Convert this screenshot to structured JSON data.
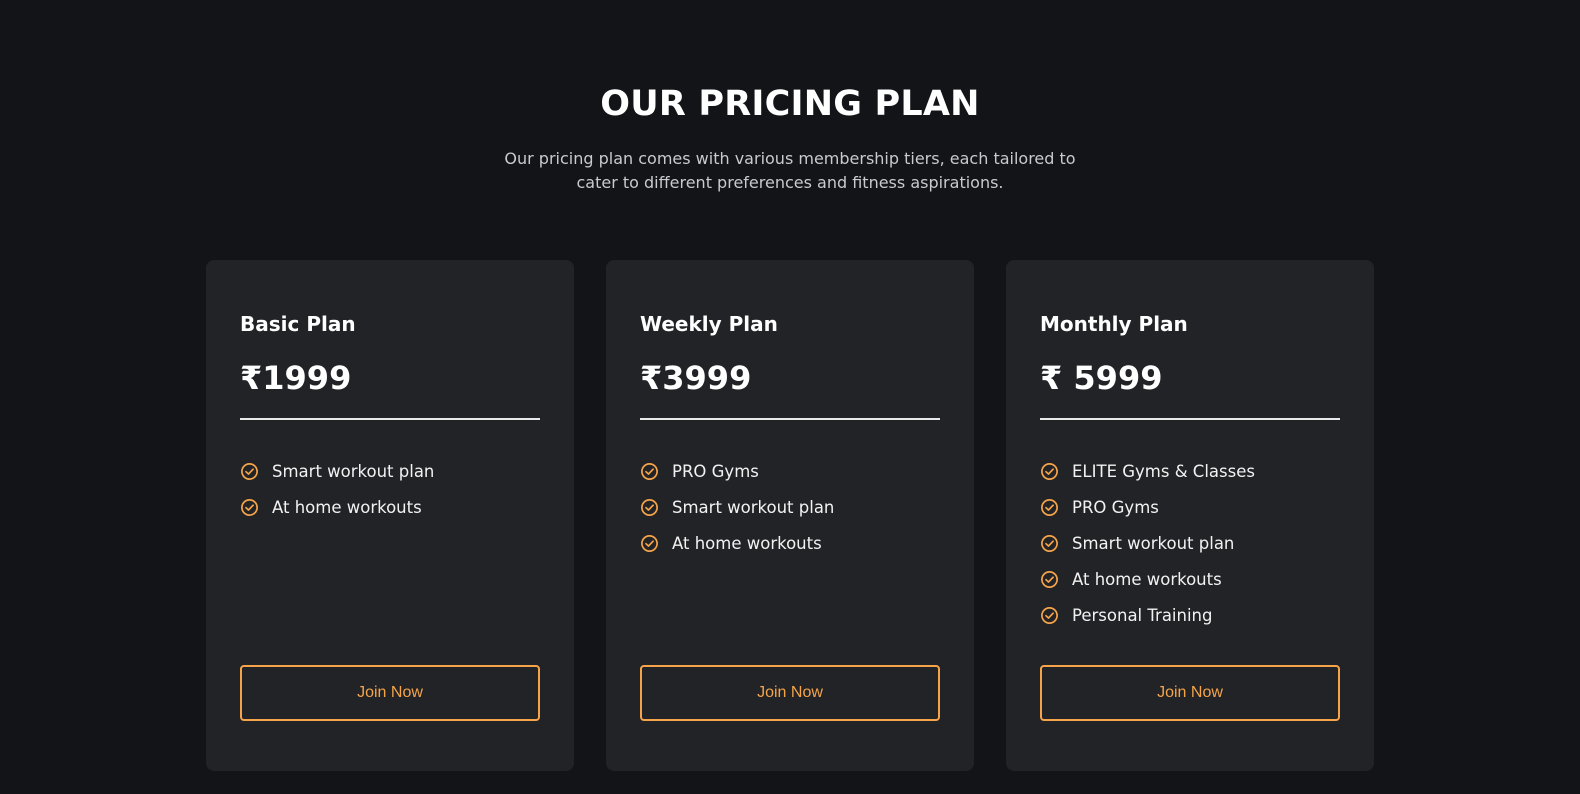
{
  "header": {
    "title": "OUR PRICING PLAN",
    "subtitle": "Our pricing plan comes with various membership tiers, each tailored to cater to different preferences and fitness aspirations."
  },
  "colors": {
    "background": "#131418",
    "card": "#222327",
    "accent": "#f5a44a"
  },
  "plans": [
    {
      "name": "Basic Plan",
      "price": "₹1999",
      "features": [
        "Smart workout plan",
        "At home workouts"
      ],
      "button_label": "Join Now"
    },
    {
      "name": "Weekly Plan",
      "price": "₹3999",
      "features": [
        "PRO Gyms",
        "Smart workout plan",
        "At home workouts"
      ],
      "button_label": "Join Now"
    },
    {
      "name": "Monthly Plan",
      "price": "₹ 5999",
      "features": [
        "ELITE Gyms & Classes",
        "PRO Gyms",
        "Smart workout plan",
        "At home workouts",
        "Personal Training"
      ],
      "button_label": "Join Now"
    }
  ],
  "feature_icon": "check-circle-icon"
}
